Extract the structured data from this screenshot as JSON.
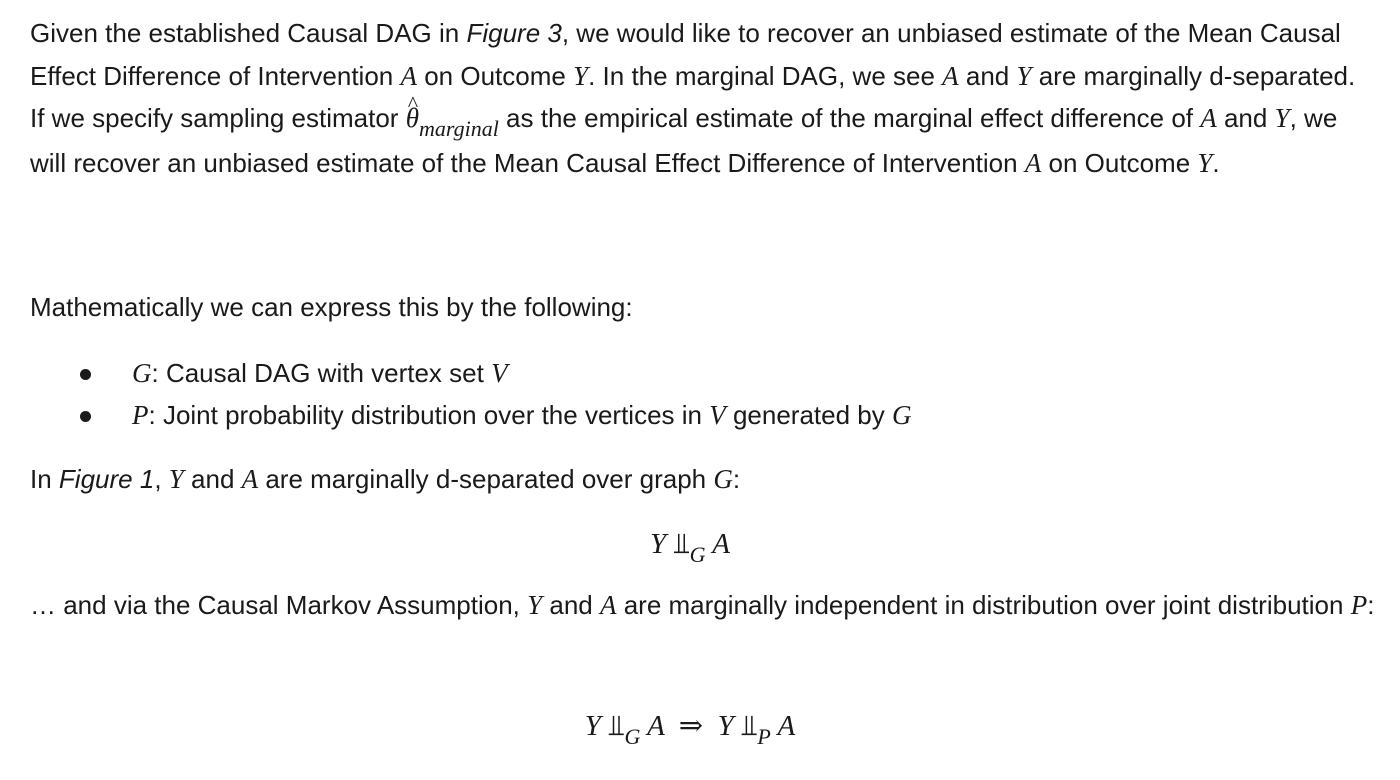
{
  "para1": {
    "s1": "Given the established Causal DAG in ",
    "fig3": "Figure 3",
    "s2": ", we would like to recover an unbiased estimate of the Mean Causal Effect Difference of Intervention ",
    "A": "A",
    "s3": " on Outcome ",
    "Y": "Y",
    "s4": ". In the marginal DAG, we see ",
    "s5": " and ",
    "s6": " are marginally d-separated. If we specify sampling estimator ",
    "theta": "θ",
    "theta_sub": "marginal",
    "s7": " as the empirical estimate of the marginal effect difference of ",
    "s8": " and ",
    "s9": ", we will recover an unbiased estimate of the Mean Causal Effect Difference of Intervention ",
    "s10": " on Outcome ",
    "s11": "."
  },
  "para2": {
    "text": "Mathematically we can express this by the following:"
  },
  "bullets": [
    {
      "sym": "G",
      "text": ": Causal DAG with vertex set ",
      "sym2": "V",
      "tail": ""
    },
    {
      "sym": "P",
      "text": ": Joint probability distribution over the vertices in ",
      "sym2": "V",
      "tail": " generated by ",
      "sym3": "G"
    }
  ],
  "para3": {
    "s1": "In ",
    "fig1": "Figure 1",
    "s2": ", ",
    "Y": "Y",
    "s3": " and ",
    "A": "A",
    "s4": " are marginally d-separated over graph ",
    "G": "G",
    "s5": ":"
  },
  "eq1": {
    "lhs": "Y",
    "sym": "⫫",
    "sub": "G",
    "rhs": "A"
  },
  "para4": {
    "s1": "… and via the Causal Markov Assumption, ",
    "Y": "Y",
    "s2": " and ",
    "A": "A",
    "s3": " are marginally independent in distribution over joint distribution ",
    "P": "P",
    "s4": ":"
  },
  "eq2": {
    "lhs": "Y",
    "sym": "⫫",
    "sub1": "G",
    "mid": "A",
    "arrow": "⇒",
    "lhs2": "Y",
    "sub2": "P",
    "rhs": "A"
  }
}
